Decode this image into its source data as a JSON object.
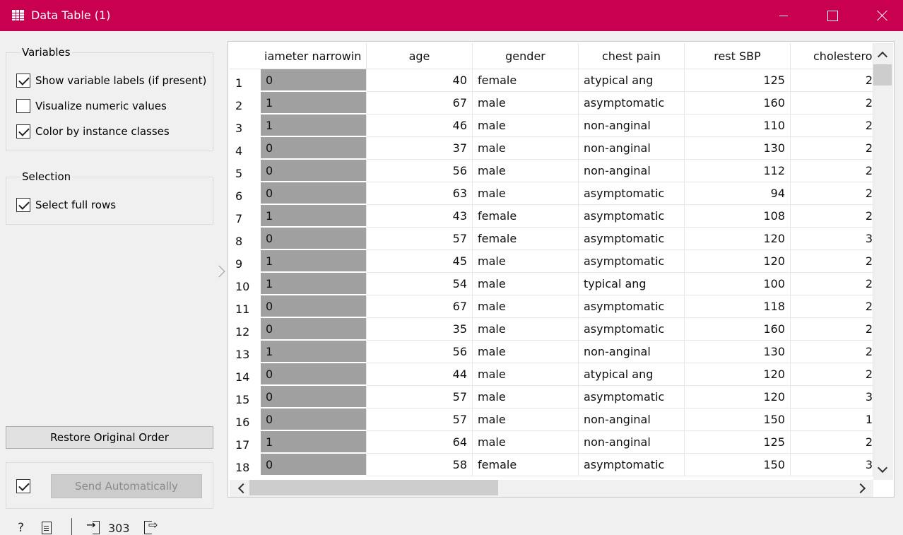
{
  "window": {
    "title": "Data Table (1)"
  },
  "variables": {
    "title": "Variables",
    "show_labels": {
      "label": "Show variable labels (if present)",
      "checked": true
    },
    "visualize_numeric": {
      "label": "Visualize numeric values",
      "checked": false
    },
    "color_by_class": {
      "label": "Color by instance classes",
      "checked": true
    }
  },
  "selection": {
    "title": "Selection",
    "select_full_rows": {
      "label": "Select full rows",
      "checked": true
    }
  },
  "buttons": {
    "restore": "Restore Original Order",
    "send": "Send Automatically",
    "send_auto_checked": true
  },
  "status": {
    "help": "?",
    "instances": "303"
  },
  "table": {
    "columns": [
      "iameter narrowin",
      "age",
      "gender",
      "chest pain",
      "rest SBP",
      "cholesterol"
    ],
    "target_color": "#a0a0a0",
    "rows": [
      {
        "n": "1",
        "target": "0",
        "age": "40",
        "gender": "female",
        "chest_pain": "atypical ang",
        "rest_sbp": "125",
        "chol": "2"
      },
      {
        "n": "2",
        "target": "1",
        "age": "67",
        "gender": "male",
        "chest_pain": "asymptomatic",
        "rest_sbp": "160",
        "chol": "2"
      },
      {
        "n": "3",
        "target": "1",
        "age": "46",
        "gender": "male",
        "chest_pain": "non-anginal",
        "rest_sbp": "110",
        "chol": "2"
      },
      {
        "n": "4",
        "target": "0",
        "age": "37",
        "gender": "male",
        "chest_pain": "non-anginal",
        "rest_sbp": "130",
        "chol": "2"
      },
      {
        "n": "5",
        "target": "0",
        "age": "56",
        "gender": "male",
        "chest_pain": "non-anginal",
        "rest_sbp": "112",
        "chol": "2"
      },
      {
        "n": "6",
        "target": "0",
        "age": "63",
        "gender": "male",
        "chest_pain": "asymptomatic",
        "rest_sbp": "94",
        "chol": "2"
      },
      {
        "n": "7",
        "target": "1",
        "age": "43",
        "gender": "female",
        "chest_pain": "asymptomatic",
        "rest_sbp": "108",
        "chol": "2"
      },
      {
        "n": "8",
        "target": "0",
        "age": "57",
        "gender": "female",
        "chest_pain": "asymptomatic",
        "rest_sbp": "120",
        "chol": "3"
      },
      {
        "n": "9",
        "target": "1",
        "age": "45",
        "gender": "male",
        "chest_pain": "asymptomatic",
        "rest_sbp": "120",
        "chol": "2"
      },
      {
        "n": "10",
        "target": "1",
        "age": "54",
        "gender": "male",
        "chest_pain": "typical ang",
        "rest_sbp": "100",
        "chol": "2"
      },
      {
        "n": "11",
        "target": "0",
        "age": "67",
        "gender": "male",
        "chest_pain": "asymptomatic",
        "rest_sbp": "118",
        "chol": "2"
      },
      {
        "n": "12",
        "target": "0",
        "age": "35",
        "gender": "male",
        "chest_pain": "asymptomatic",
        "rest_sbp": "160",
        "chol": "2"
      },
      {
        "n": "13",
        "target": "1",
        "age": "56",
        "gender": "male",
        "chest_pain": "non-anginal",
        "rest_sbp": "130",
        "chol": "2"
      },
      {
        "n": "14",
        "target": "0",
        "age": "44",
        "gender": "male",
        "chest_pain": "atypical ang",
        "rest_sbp": "120",
        "chol": "2"
      },
      {
        "n": "15",
        "target": "0",
        "age": "57",
        "gender": "male",
        "chest_pain": "asymptomatic",
        "rest_sbp": "120",
        "chol": "3"
      },
      {
        "n": "16",
        "target": "0",
        "age": "57",
        "gender": "male",
        "chest_pain": "non-anginal",
        "rest_sbp": "150",
        "chol": "1"
      },
      {
        "n": "17",
        "target": "1",
        "age": "64",
        "gender": "male",
        "chest_pain": "non-anginal",
        "rest_sbp": "125",
        "chol": "2"
      },
      {
        "n": "18",
        "target": "0",
        "age": "58",
        "gender": "female",
        "chest_pain": "asymptomatic",
        "rest_sbp": "150",
        "chol": "3"
      }
    ]
  }
}
